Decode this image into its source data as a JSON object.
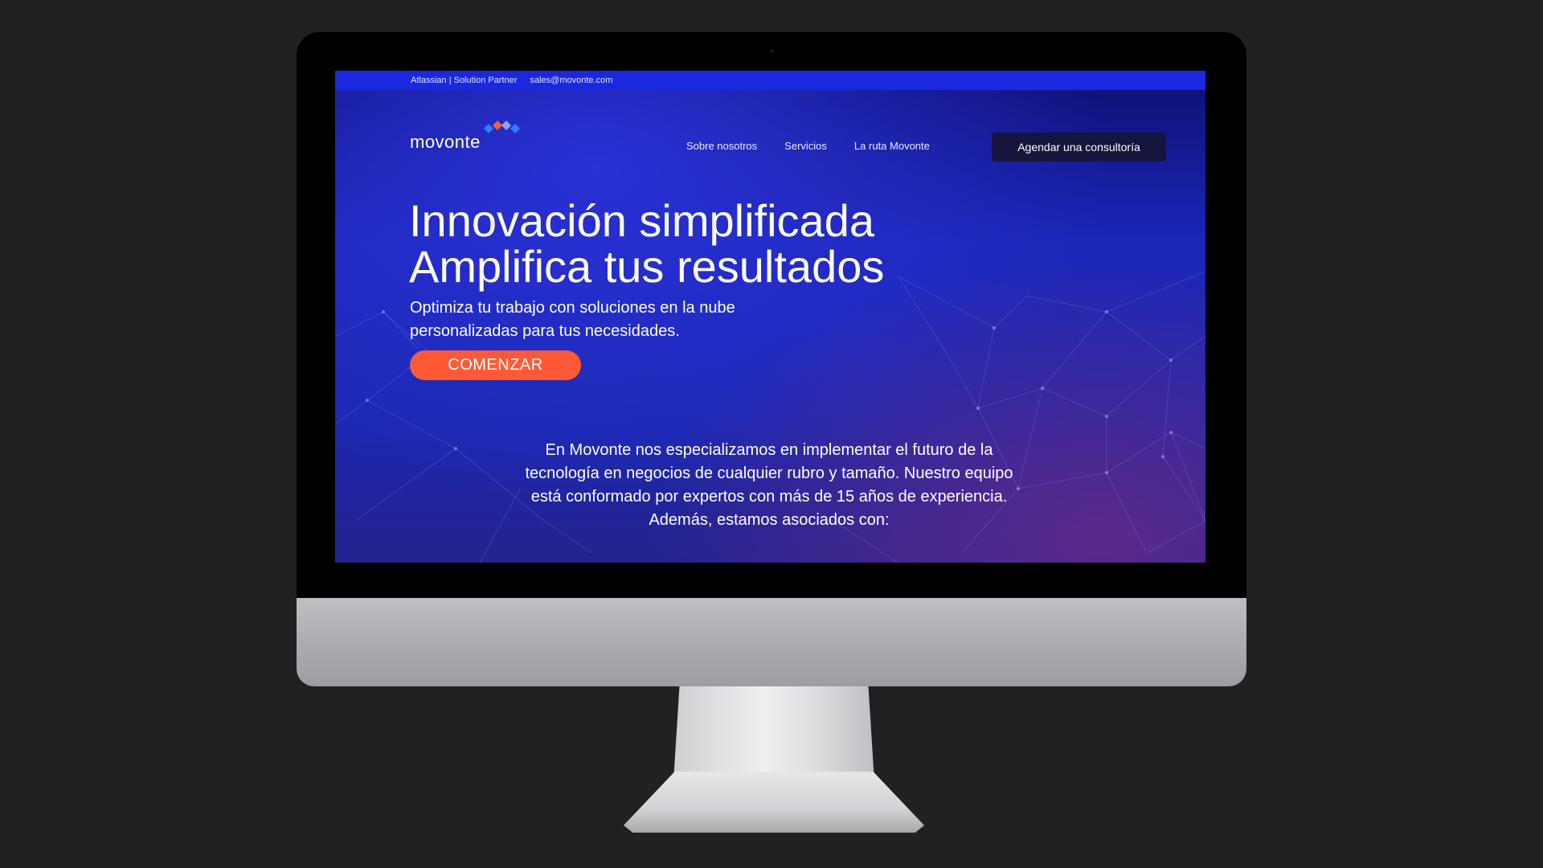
{
  "topbar": {
    "partner": "Atlassian | Solution Partner",
    "email": "sales@movonte.com"
  },
  "brand": {
    "logo_text": "movonte",
    "colors": {
      "primary_blue": "#1c26b8",
      "accent_orange": "#ff5a35",
      "dark_button": "#15153d"
    }
  },
  "nav": {
    "items": [
      "Sobre nosotros",
      "Servicios",
      "La ruta Movonte"
    ],
    "cta": "Agendar una consultoría"
  },
  "hero": {
    "title_line1": "Innovación simplificada",
    "title_line2": "Amplifica tus resultados",
    "subtitle_line1": "Optimiza tu trabajo con soluciones en la nube",
    "subtitle_line2": "personalizadas para tus necesidades.",
    "button": "COMENZAR"
  },
  "about": {
    "line1": "En Movonte nos especializamos en implementar el futuro de la",
    "line2": "tecnología en negocios de cualquier rubro y tamaño. Nuestro equipo",
    "line3": "está conformado por expertos con más de 15 años de experiencia.",
    "line4": "Además, estamos asociados con:"
  }
}
